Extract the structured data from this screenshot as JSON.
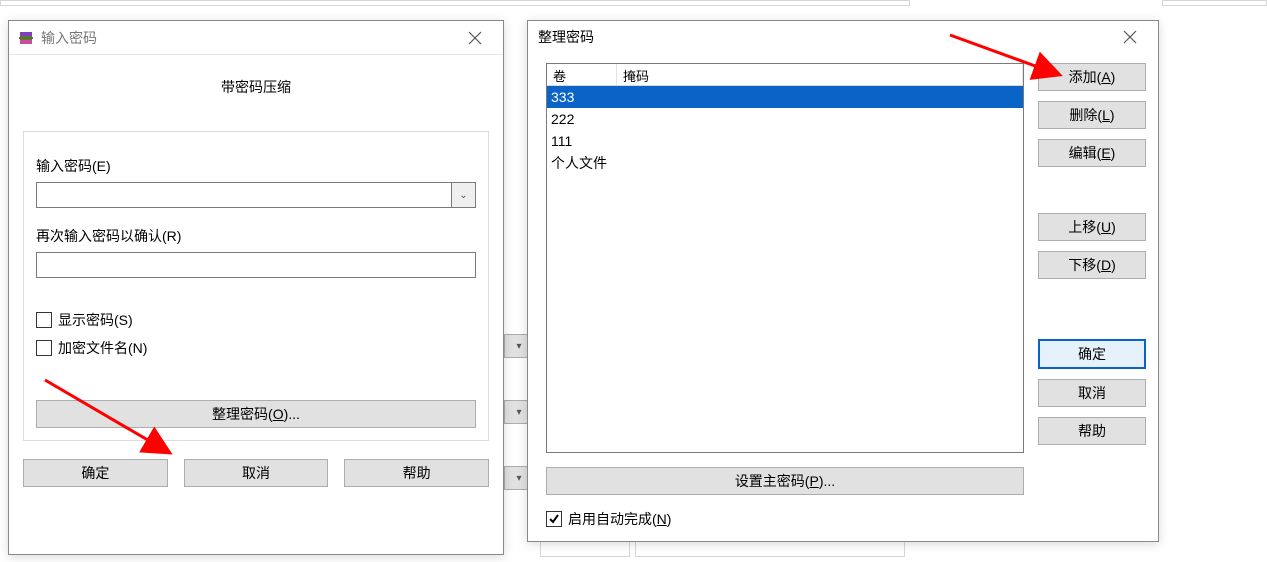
{
  "bg": {
    "topStub": ""
  },
  "dlgPwd": {
    "title": "输入密码",
    "sectionTitle": "带密码压缩",
    "enterPwdLabel": "输入密码(E)",
    "pwdValue": "",
    "confirmLabel": "再次输入密码以确认(R)",
    "confirmValue": "",
    "showPwdLabel": "显示密码(S)",
    "encryptNamesLabel": "加密文件名(N)",
    "organizeBtnPrefix": "整理密码(",
    "organizeBtnKey": "O",
    "organizeBtnSuffix": ")...",
    "okLabel": "确定",
    "cancelLabel": "取消",
    "helpLabel": "帮助"
  },
  "dlgMgr": {
    "title": "整理密码",
    "col1": "卷",
    "col2": "掩码",
    "rows": [
      {
        "vol": "333",
        "mask": "",
        "selected": true
      },
      {
        "vol": "222",
        "mask": "",
        "selected": false
      },
      {
        "vol": "111",
        "mask": "",
        "selected": false
      },
      {
        "vol": "个人文件",
        "mask": "",
        "selected": false
      }
    ],
    "setMasterPrefix": "设置主密码(",
    "setMasterKey": "P",
    "setMasterSuffix": ")...",
    "autoCompletePrefix": "启用自动完成(",
    "autoCompleteKey": "N",
    "autoCompleteSuffix": ")",
    "addPrefix": "添加(",
    "addKey": "A",
    "addSuffix": ")",
    "delPrefix": "删除(",
    "delKey": "L",
    "delSuffix": ")",
    "editPrefix": "编辑(",
    "editKey": "E",
    "editSuffix": ")",
    "upPrefix": "上移(",
    "upKey": "U",
    "upSuffix": ")",
    "downPrefix": "下移(",
    "downKey": "D",
    "downSuffix": ")",
    "okLabel": "确定",
    "cancelLabel": "取消",
    "helpLabel": "帮助"
  }
}
